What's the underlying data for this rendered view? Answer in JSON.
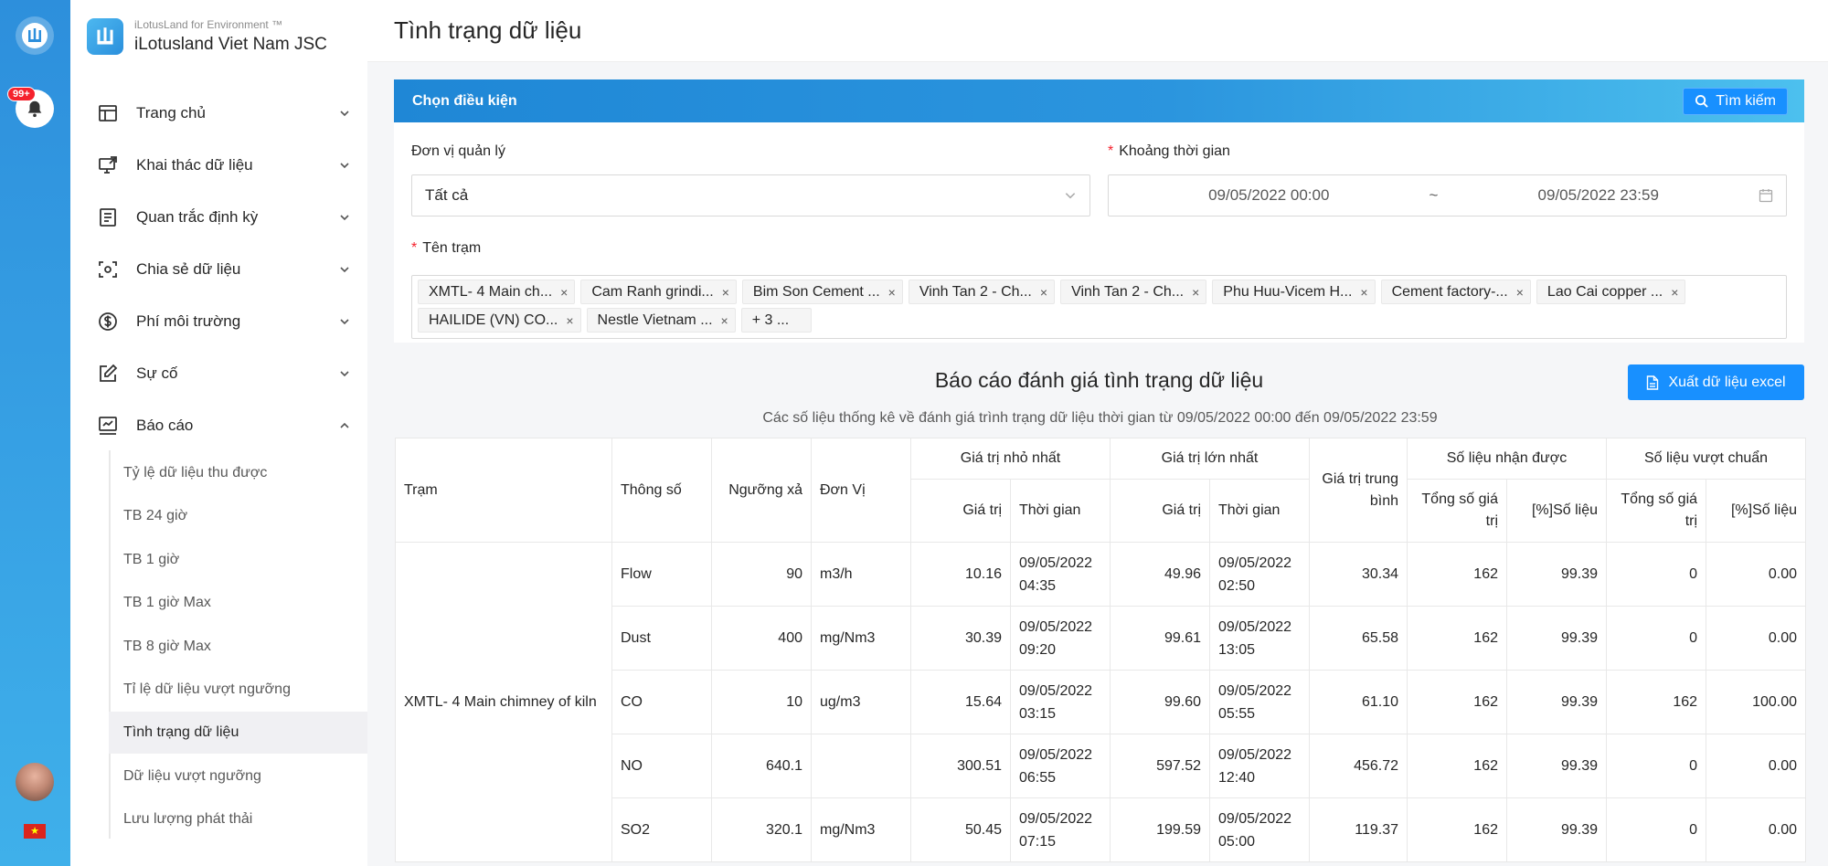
{
  "org": {
    "subtitle": "iLotusLand for Environment ™",
    "name": "iLotusland Viet Nam JSC"
  },
  "rail": {
    "badge": "99+",
    "flag_star": "★"
  },
  "menu": [
    {
      "label": "Trang chủ",
      "icon": "home-layout-icon"
    },
    {
      "label": "Khai thác dữ liệu",
      "icon": "monitor-share-icon"
    },
    {
      "label": "Quan trắc định kỳ",
      "icon": "document-list-icon"
    },
    {
      "label": "Chia sẻ dữ liệu",
      "icon": "scan-share-icon"
    },
    {
      "label": "Phí môi trường",
      "icon": "dollar-circle-icon"
    },
    {
      "label": "Sự cố",
      "icon": "edit-square-icon"
    },
    {
      "label": "Báo cáo",
      "icon": "report-chart-icon"
    }
  ],
  "submenu": [
    {
      "label": "Tỷ lệ dữ liệu thu được"
    },
    {
      "label": "TB 24 giờ"
    },
    {
      "label": "TB 1 giờ"
    },
    {
      "label": "TB 1 giờ Max"
    },
    {
      "label": "TB 8 giờ Max"
    },
    {
      "label": "Tỉ lệ dữ liệu vượt ngưỡng"
    },
    {
      "label": "Tình trạng dữ liệu"
    },
    {
      "label": "Dữ liệu vượt ngưỡng"
    },
    {
      "label": "Lưu lượng phát thải"
    }
  ],
  "page": {
    "title": "Tình trạng dữ liệu"
  },
  "filter": {
    "title": "Chọn điều kiện",
    "search_label": "Tìm kiếm",
    "unit_label": "Đơn vị quản lý",
    "unit_value": "Tất cả",
    "time_label": "Khoảng thời gian",
    "time_from": "09/05/2022 00:00",
    "time_sep": "~",
    "time_to": "09/05/2022 23:59",
    "station_label": "Tên trạm",
    "required_mark": "*",
    "stations": [
      "XMTL- 4 Main ch...",
      "Cam Ranh grindi...",
      "Bim Son Cement ...",
      "Vinh Tan 2 - Ch...",
      "Vinh Tan 2 - Ch...",
      "Phu Huu-Vicem H...",
      "Cement factory-...",
      "Lao Cai copper ...",
      "HAILIDE (VN) CO...",
      "Nestle Vietnam ..."
    ],
    "more": "+ 3 ...",
    "remove_mark": "×"
  },
  "report": {
    "title": "Báo cáo đánh giá tình trạng dữ liệu",
    "export_label": "Xuất dữ liệu excel",
    "subtitle": "Các số liệu thống kê về đánh giá trình trạng dữ liệu thời gian từ 09/05/2022 00:00 đến 09/05/2022 23:59"
  },
  "table": {
    "headers": {
      "station": "Trạm",
      "param": "Thông số",
      "threshold": "Ngưỡng xả",
      "unit": "Đơn Vị",
      "min": "Giá trị nhỏ nhất",
      "max": "Giá trị lớn nhất",
      "avg": "Giá trị trung bình",
      "received": "Số liệu nhận được",
      "exceed": "Số liệu vượt chuẩn",
      "value": "Giá trị",
      "time": "Thời gian",
      "total": "Tổng số giá trị",
      "percent": "[%]Số liệu"
    },
    "station_name": "XMTL- 4 Main chimney of kiln",
    "rows": [
      {
        "param": "Flow",
        "threshold": "90",
        "unit": "m3/h",
        "min_val": "10.16",
        "min_time": "09/05/2022 04:35",
        "max_val": "49.96",
        "max_time": "09/05/2022 02:50",
        "avg": "30.34",
        "rec_total": "162",
        "rec_pct": "99.39",
        "exc_total": "0",
        "exc_pct": "0.00"
      },
      {
        "param": "Dust",
        "threshold": "400",
        "unit": "mg/Nm3",
        "min_val": "30.39",
        "min_time": "09/05/2022 09:20",
        "max_val": "99.61",
        "max_time": "09/05/2022 13:05",
        "avg": "65.58",
        "rec_total": "162",
        "rec_pct": "99.39",
        "exc_total": "0",
        "exc_pct": "0.00"
      },
      {
        "param": "CO",
        "threshold": "10",
        "unit": "ug/m3",
        "min_val": "15.64",
        "min_time": "09/05/2022 03:15",
        "max_val": "99.60",
        "max_time": "09/05/2022 05:55",
        "avg": "61.10",
        "rec_total": "162",
        "rec_pct": "99.39",
        "exc_total": "162",
        "exc_pct": "100.00"
      },
      {
        "param": "NO",
        "threshold": "640.1",
        "unit": "",
        "min_val": "300.51",
        "min_time": "09/05/2022 06:55",
        "max_val": "597.52",
        "max_time": "09/05/2022 12:40",
        "avg": "456.72",
        "rec_total": "162",
        "rec_pct": "99.39",
        "exc_total": "0",
        "exc_pct": "0.00"
      },
      {
        "param": "SO2",
        "threshold": "320.1",
        "unit": "mg/Nm3",
        "min_val": "50.45",
        "min_time": "09/05/2022 07:15",
        "max_val": "199.59",
        "max_time": "09/05/2022 05:00",
        "avg": "119.37",
        "rec_total": "162",
        "rec_pct": "99.39",
        "exc_total": "0",
        "exc_pct": "0.00"
      }
    ]
  }
}
